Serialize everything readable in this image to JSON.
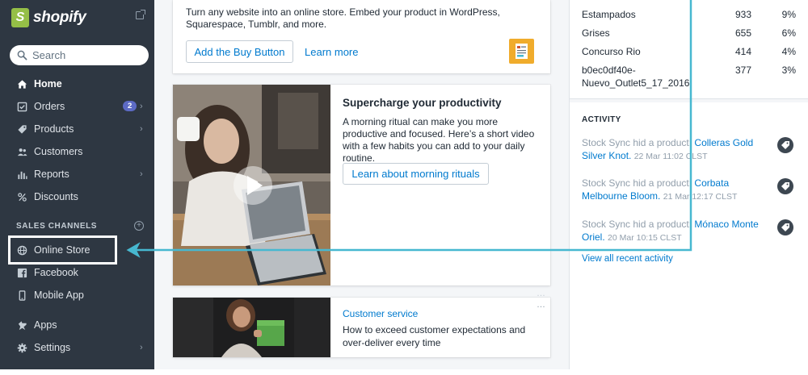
{
  "brand": {
    "name": "shopify"
  },
  "search": {
    "placeholder": "Search"
  },
  "nav": {
    "home": "Home",
    "orders": "Orders",
    "orders_badge": "2",
    "products": "Products",
    "customers": "Customers",
    "reports": "Reports",
    "discounts": "Discounts",
    "sales_channels_title": "SALES CHANNELS",
    "online_store": "Online Store",
    "facebook": "Facebook",
    "mobile_app": "Mobile App",
    "apps": "Apps",
    "settings": "Settings"
  },
  "buy_button_card": {
    "text": "Turn any website into an online store. Embed your product in WordPress, Squarespace, Tumblr, and more.",
    "primary_label": "Add the Buy Button",
    "secondary_label": "Learn more"
  },
  "productivity_card": {
    "title": "Supercharge your productivity",
    "text": "A morning ritual can make you more productive and focused. Here’s a short video with a few habits you can add to your daily routine.",
    "button_label": "Learn about morning rituals"
  },
  "customer_card": {
    "category": "Customer service",
    "text": "How to exceed customer expectations and over-deliver every time",
    "menu": "…"
  },
  "top_products": [
    {
      "name": "Estampados",
      "count": "933",
      "pct": "9%"
    },
    {
      "name": "Grises",
      "count": "655",
      "pct": "6%"
    },
    {
      "name": "Concurso Rio",
      "count": "414",
      "pct": "4%"
    },
    {
      "name": "b0ec0df40e-",
      "name2": "Nuevo_Outlet5_17_2016",
      "count": "377",
      "pct": "3%"
    }
  ],
  "activity": {
    "title": "ACTIVITY",
    "items": [
      {
        "prefix": "Stock Sync hid a product:",
        "link": "Colleras Gold Silver Knot.",
        "time": "22 Mar 11:02 CLST"
      },
      {
        "prefix": "Stock Sync hid a product:",
        "link": "Corbata Melbourne Bloom.",
        "time": "21 Mar 12:17 CLST"
      },
      {
        "prefix": "Stock Sync hid a product:",
        "link": "Mónaco Monte Oriel.",
        "time": "20 Mar 10:15 CLST"
      }
    ],
    "view_all": "View all recent activity"
  },
  "colors": {
    "sidebar": "#2e3742",
    "accent": "#007ace",
    "annotation": "#47b8d0",
    "badge": "#5c6ac4",
    "brand_green": "#95bf47"
  }
}
